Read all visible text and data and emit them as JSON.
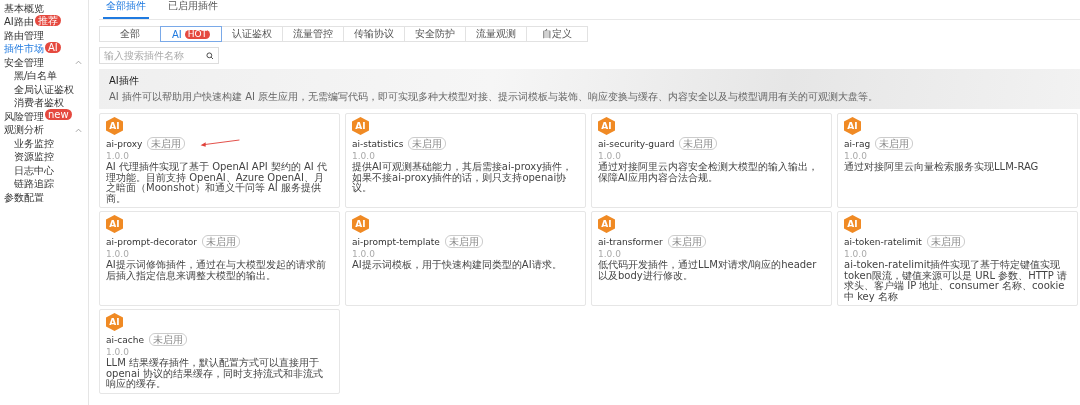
{
  "sidebar": {
    "items": [
      {
        "label": "基本概览",
        "selected": false
      },
      {
        "label": "AI路由",
        "selected": false,
        "badge": "推荐"
      },
      {
        "label": "路由管理",
        "selected": false
      },
      {
        "label": "插件市场",
        "selected": true,
        "badge": "AI"
      },
      {
        "label": "安全管理",
        "selected": false,
        "expanded": true,
        "children": [
          {
            "label": "黑/白名单",
            "selected": false
          },
          {
            "label": "全局认证鉴权",
            "selected": false
          },
          {
            "label": "消费者鉴权",
            "selected": false
          }
        ]
      },
      {
        "label": "风险管理",
        "selected": false,
        "badge": "new"
      },
      {
        "label": "观测分析",
        "selected": false,
        "expanded": true,
        "children": [
          {
            "label": "业务监控",
            "selected": false
          },
          {
            "label": "资源监控",
            "selected": false
          },
          {
            "label": "日志中心",
            "selected": false
          },
          {
            "label": "链路追踪",
            "selected": false
          }
        ]
      },
      {
        "label": "参数配置",
        "selected": false
      }
    ]
  },
  "tabs": [
    {
      "label": "全部插件",
      "selected": true
    },
    {
      "label": "已启用插件",
      "selected": false
    }
  ],
  "filters": [
    {
      "label": "全部",
      "selected": false
    },
    {
      "label": "AI",
      "selected": true,
      "badge": "HOT"
    },
    {
      "label": "认证鉴权",
      "selected": false
    },
    {
      "label": "流量管控",
      "selected": false
    },
    {
      "label": "传输协议",
      "selected": false
    },
    {
      "label": "安全防护",
      "selected": false
    },
    {
      "label": "流量观测",
      "selected": false
    },
    {
      "label": "自定义",
      "selected": false
    }
  ],
  "search": {
    "placeholder": "输入搜索插件名称"
  },
  "banner": {
    "title": "AI插件",
    "description": "AI 插件可以帮助用户快速构建 AI 原生应用，无需编写代码，即可实现多种大模型对接、提示词模板与装饰、响应变换与缓存、内容安全以及与模型调用有关的可观测大盘等。"
  },
  "plugins": [
    {
      "icon_text": "AI",
      "name": "ai-proxy",
      "status": "未启用",
      "version": "1.0.0",
      "description": "AI 代理插件实现了基于 OpenAI API 契约的 AI 代理功能。目前支持 OpenAI、Azure OpenAI、月之暗面（Moonshot）和通义千问等 AI 服务提供商。",
      "annotated": true
    },
    {
      "icon_text": "AI",
      "name": "ai-statistics",
      "status": "未启用",
      "version": "1.0.0",
      "description": "提供AI可观测基础能力，其后需接ai-proxy插件，如果不接ai-proxy插件的话，则只支持openai协议。",
      "annotated": false
    },
    {
      "icon_text": "AI",
      "name": "ai-security-guard",
      "status": "未启用",
      "version": "1.0.0",
      "description": "通过对接阿里云内容安全检测大模型的输入输出，保障AI应用内容合法合规。",
      "annotated": false
    },
    {
      "icon_text": "AI",
      "name": "ai-rag",
      "status": "未启用",
      "version": "1.0.0",
      "description": "通过对接阿里云向量检索服务实现LLM-RAG",
      "annotated": false
    },
    {
      "icon_text": "AI",
      "name": "ai-prompt-decorator",
      "status": "未启用",
      "version": "1.0.0",
      "description": "AI提示词修饰插件，通过在与大模型发起的请求前后插入指定信息来调整大模型的输出。",
      "annotated": false
    },
    {
      "icon_text": "AI",
      "name": "ai-prompt-template",
      "status": "未启用",
      "version": "1.0.0",
      "description": "AI提示词模板，用于快速构建同类型的AI请求。",
      "annotated": false
    },
    {
      "icon_text": "AI",
      "name": "ai-transformer",
      "status": "未启用",
      "version": "1.0.0",
      "description": "低代码开发插件，通过LLM对请求/响应的header以及body进行修改。",
      "annotated": false
    },
    {
      "icon_text": "AI",
      "name": "ai-token-ratelimit",
      "status": "未启用",
      "version": "1.0.0",
      "description": "ai-token-ratelimit插件实现了基于特定键值实现token限流，键值来源可以是 URL 参数、HTTP 请求头、客户端 IP 地址、consumer 名称、cookie中 key 名称",
      "annotated": false
    },
    {
      "icon_text": "AI",
      "name": "ai-cache",
      "status": "未启用",
      "version": "1.0.0",
      "description": "LLM 结果缓存插件，默认配置方式可以直接用于 openai 协议的结果缓存，同时支持流式和非流式响应的缓存。",
      "annotated": false
    }
  ]
}
